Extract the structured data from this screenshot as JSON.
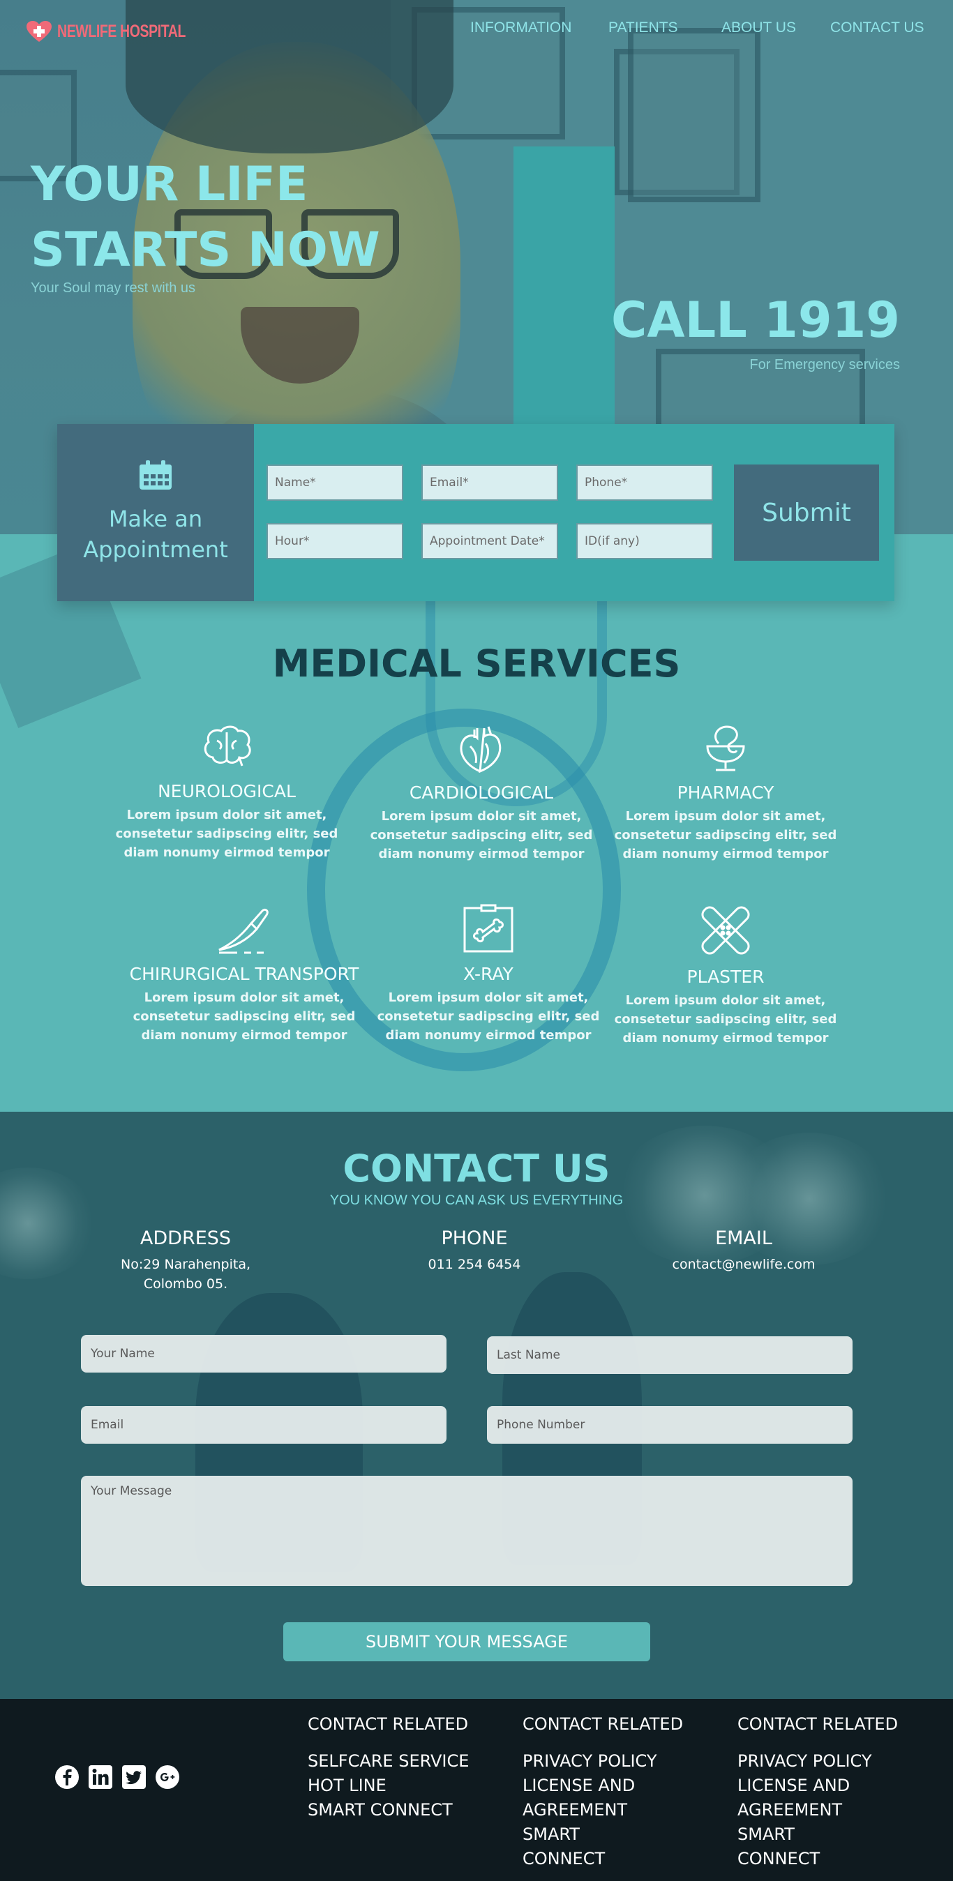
{
  "brand": {
    "name": "NEWLIFE HOSPITAL",
    "logo_icon": "heart-cross-icon",
    "logo_color": "#f06a78"
  },
  "nav": {
    "items": [
      "INFORMATION",
      "PATIENTS",
      "ABOUT US",
      "CONTACT US"
    ]
  },
  "hero": {
    "title": "YOUR LIFE STARTS NOW",
    "subtitle": "Your Soul may rest with us",
    "call": "CALL 1919",
    "call_sub": "For Emergency services"
  },
  "appointment": {
    "title": "Make an Appointment",
    "icon": "calendar-icon",
    "fields": {
      "name": "Name*",
      "email": "Email*",
      "phone": "Phone*",
      "hour": "Hour*",
      "date": "Appointment Date*",
      "id": "ID(if any)"
    },
    "submit": "Submit"
  },
  "services": {
    "title": "MEDICAL SERVICES",
    "items": [
      {
        "name": "NEUROLOGICAL",
        "icon": "brain-icon",
        "desc": "Lorem ipsum dolor sit amet, consetetur sadipscing elitr, sed diam nonumy eirmod tempor"
      },
      {
        "name": "CARDIOLOGICAL",
        "icon": "heart-organ-icon",
        "desc": "Lorem ipsum dolor sit amet, consetetur sadipscing elitr, sed diam nonumy eirmod tempor"
      },
      {
        "name": "PHARMACY",
        "icon": "pharmacy-bowl-icon",
        "desc": "Lorem ipsum dolor sit amet, consetetur sadipscing elitr, sed diam nonumy eirmod tempor"
      },
      {
        "name": "CHIRURGICAL TRANSPORT",
        "icon": "scalpel-icon",
        "desc": "Lorem ipsum dolor sit amet, consetetur sadipscing elitr, sed diam nonumy eirmod tempor"
      },
      {
        "name": "X-RAY",
        "icon": "xray-bone-icon",
        "desc": "Lorem ipsum dolor sit amet, consetetur sadipscing elitr, sed diam nonumy eirmod tempor"
      },
      {
        "name": "PLASTER",
        "icon": "plaster-icon",
        "desc": "Lorem ipsum dolor sit amet, consetetur sadipscing elitr, sed diam nonumy eirmod tempor"
      }
    ]
  },
  "contact": {
    "title": "CONTACT US",
    "subtitle": "YOU KNOW YOU CAN ASK US EVERYTHING",
    "address": {
      "label": "ADDRESS",
      "line1": "No:29 Narahenpita,",
      "line2": "Colombo 05."
    },
    "phone": {
      "label": "PHONE",
      "value": "011 254 6454"
    },
    "email": {
      "label": "EMAIL",
      "value": "contact@newlife.com"
    },
    "form": {
      "first_name": "Your Name",
      "last_name": "Last Name",
      "email": "Email",
      "phone": "Phone Number",
      "message": "Your Message",
      "submit": "SUBMIT YOUR MESSAGE"
    }
  },
  "footer": {
    "social": [
      "facebook-icon",
      "linkedin-icon",
      "twitter-icon",
      "google-plus-icon"
    ],
    "columns": [
      {
        "heading": "CONTACT RELATED",
        "links": [
          "SELFCARE SERVICE",
          "HOT LINE",
          "SMART CONNECT"
        ]
      },
      {
        "heading": "CONTACT RELATED",
        "links": [
          "PRIVACY POLICY",
          "LICENSE AND AGREEMENT",
          "SMART CONNECT"
        ]
      },
      {
        "heading": "CONTACT RELATED",
        "links": [
          "PRIVACY POLICY",
          "LICENSE AND AGREEMENT",
          "SMART CONNECT"
        ]
      }
    ]
  },
  "colors": {
    "accent": "#8ce7ea",
    "teal": "#3aa8a8",
    "slate": "#436b7d",
    "services_bg": "#5ab7b6",
    "footer_bg": "#0f1a1f"
  }
}
